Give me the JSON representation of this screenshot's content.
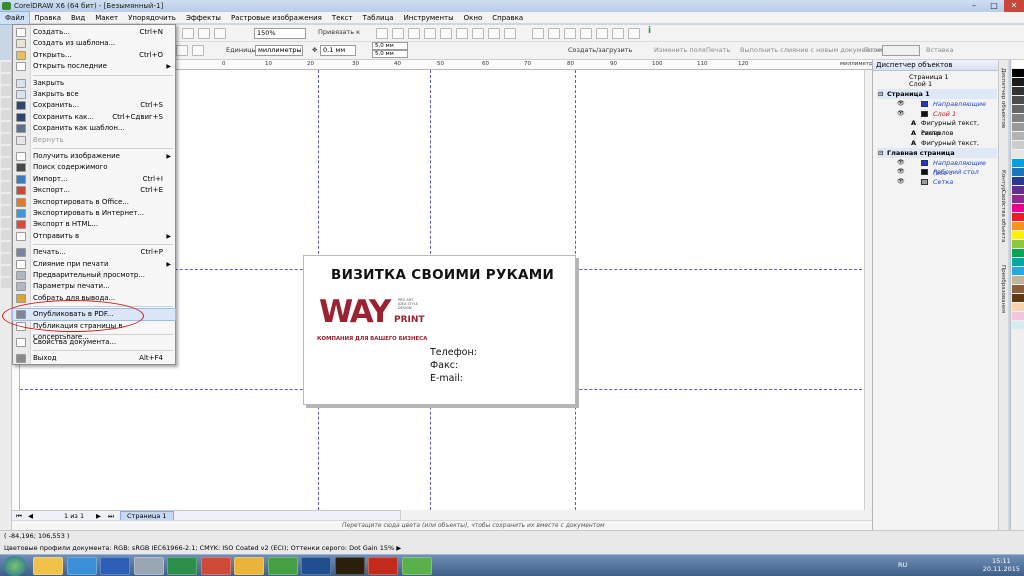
{
  "window": {
    "title": "CorelDRAW X6 (64 бит) - [Безымянный-1]"
  },
  "menubar": [
    "Файл",
    "Правка",
    "Вид",
    "Макет",
    "Упорядочить",
    "Эффекты",
    "Растровые изображения",
    "Текст",
    "Таблица",
    "Инструменты",
    "Окно",
    "Справка"
  ],
  "toolbar": {
    "zoom": "150%",
    "snap_label": "Привязать к",
    "units_label": "Единицы:",
    "units_value": "миллиметры",
    "nudge": "0,1 мм",
    "dup_x": "5,0 мм",
    "dup_y": "5,0 мм",
    "create_upload": "Создать/загрузить",
    "change_fields": "Изменить поля",
    "print": "Печать",
    "merge": "Выполнить слияние с новым документом",
    "field_label": "Поле:",
    "insert": "Вставка"
  },
  "ruler_h": [
    "-30",
    "-20",
    "0",
    "10",
    "20",
    "30",
    "40",
    "50",
    "60",
    "70",
    "80",
    "90",
    "100",
    "110",
    "120",
    "миллиметры"
  ],
  "file_menu": [
    {
      "label": "Создать...",
      "shortcut": "Ctrl+N",
      "icon": "new-doc-icon",
      "color": "#ffffff"
    },
    {
      "label": "Создать из шаблона...",
      "shortcut": "",
      "icon": "template-icon",
      "color": "#e9e3cf"
    },
    {
      "label": "Открыть...",
      "shortcut": "Ctrl+O",
      "icon": "open-icon",
      "color": "#e7c25a"
    },
    {
      "label": "Открыть последние",
      "shortcut": "",
      "icon": "recent-icon",
      "color": "#ffffff",
      "submenu": true
    },
    {
      "sep": true
    },
    {
      "label": "Закрыть",
      "shortcut": "",
      "icon": "close-doc-icon",
      "color": "#d8e3f1"
    },
    {
      "label": "Закрыть все",
      "shortcut": "",
      "icon": "close-all-icon",
      "color": "#d8e3f1"
    },
    {
      "label": "Сохранить...",
      "shortcut": "Ctrl+S",
      "icon": "save-icon",
      "color": "#30466f"
    },
    {
      "label": "Сохранить как...",
      "shortcut": "Ctrl+Сдвиг+S",
      "icon": "save-as-icon",
      "color": "#30466f"
    },
    {
      "label": "Сохранить как шаблон...",
      "shortcut": "",
      "icon": "save-template-icon",
      "color": "#5c6f8f"
    },
    {
      "label": "Вернуть",
      "shortcut": "",
      "icon": "revert-icon",
      "color": "#e6e6e6",
      "disabled": true
    },
    {
      "sep": true
    },
    {
      "label": "Получить изображение",
      "shortcut": "",
      "icon": "acquire-icon",
      "color": "#ffffff",
      "submenu": true
    },
    {
      "label": "Поиск содержимого",
      "shortcut": "",
      "icon": "search-icon",
      "color": "#4a4a4a"
    },
    {
      "label": "Импорт...",
      "shortcut": "Ctrl+I",
      "icon": "import-icon",
      "color": "#3a7bc8"
    },
    {
      "label": "Экспорт...",
      "shortcut": "Ctrl+E",
      "icon": "export-icon",
      "color": "#c84a3a"
    },
    {
      "label": "Экспортировать в Office...",
      "shortcut": "",
      "icon": "office-icon",
      "color": "#e07b2a"
    },
    {
      "label": "Экспортировать в Интернет...",
      "shortcut": "",
      "icon": "web-export-icon",
      "color": "#3a9ad9"
    },
    {
      "label": "Экспорт в HTML...",
      "shortcut": "",
      "icon": "html-icon",
      "color": "#d84a3a"
    },
    {
      "label": "Отправить в",
      "shortcut": "",
      "icon": "send-icon",
      "color": "#ffffff",
      "submenu": true
    },
    {
      "sep": true
    },
    {
      "label": "Печать...",
      "shortcut": "Ctrl+P",
      "icon": "print-icon",
      "color": "#7a8699"
    },
    {
      "label": "Слияние при печати",
      "shortcut": "",
      "icon": "merge-icon",
      "color": "#ffffff",
      "submenu": true
    },
    {
      "label": "Предварительный просмотр...",
      "shortcut": "",
      "icon": "preview-icon",
      "color": "#b0b8c4"
    },
    {
      "label": "Параметры печати...",
      "shortcut": "",
      "icon": "print-settings-icon",
      "color": "#b0b8c4"
    },
    {
      "label": "Собрать для вывода...",
      "shortcut": "",
      "icon": "collect-icon",
      "color": "#d7a63a"
    },
    {
      "sep": true
    },
    {
      "label": "Опубликовать в PDF...",
      "shortcut": "",
      "icon": "pdf-icon",
      "color": "#7a8699",
      "highlight": true
    },
    {
      "label": "Публикация страницы в ConceptShare...",
      "shortcut": "",
      "icon": "conceptshare-icon",
      "color": "#ffffff"
    },
    {
      "sep": true
    },
    {
      "label": "Свойства документа...",
      "shortcut": "",
      "icon": "properties-icon",
      "color": "#ffffff"
    },
    {
      "sep": true
    },
    {
      "label": "Выход",
      "shortcut": "Alt+F4",
      "icon": "exit-icon",
      "color": "#8a8a8a"
    }
  ],
  "card": {
    "title": "ВИЗИТКА СВОИМИ РУКАМИ",
    "logo_way": "WAY",
    "logo_print": "PRINT",
    "logo_small": "PRO ART IDEA STYLE DESIGN",
    "logo_tagline": "КОМПАНИЯ ДЛЯ ВАШЕГО БИЗНЕСА",
    "phone": "Телефон:",
    "fax": "Факс:",
    "email": "E-mail:"
  },
  "page_nav": {
    "counter": "1 из 1",
    "tab": "Страница 1"
  },
  "palette_hint": "Перетащите сюда цвета (или объекты), чтобы сохранить их вместе с документом",
  "status": {
    "coords": "( -84,196; 106,553 )",
    "profile": "Цветовые профили документа: RGB: sRGB IEC61966-2.1; CMYK: ISO Coated v2 (ECI); Оттенки серого: Dot Gain 15% ▶"
  },
  "docker": {
    "title": "Диспетчер объектов",
    "page_info": [
      "Страница 1",
      "Слой 1"
    ],
    "tree": [
      {
        "label": "Страница 1",
        "level": 0,
        "group": true,
        "style": "bold"
      },
      {
        "label": "Направляющие",
        "level": 1,
        "style": "blue",
        "swatch": "#1f37d6"
      },
      {
        "label": "Слой 1",
        "level": 1,
        "style": "red",
        "swatch": "#111111"
      },
      {
        "label": "Фигурный текст, символов",
        "level": 2,
        "style": "normal"
      },
      {
        "label": "Растр",
        "level": 2,
        "style": "normal"
      },
      {
        "label": "Фигурный текст, символов",
        "level": 2,
        "style": "normal"
      },
      {
        "label": "Главная страница",
        "level": 0,
        "group": true,
        "style": "bold"
      },
      {
        "label": "Направляющие (все с",
        "level": 1,
        "style": "blue",
        "swatch": "#1f37d6"
      },
      {
        "label": "Рабочий стол",
        "level": 1,
        "style": "blue",
        "swatch": "#111111"
      },
      {
        "label": "Сетка",
        "level": 1,
        "style": "blue",
        "swatch": "#9a9a9a"
      }
    ]
  },
  "docker_tabs": [
    "Диспетчер объектов",
    "Контур",
    "Свойства объекта",
    "Преобразования"
  ],
  "palette_colors": [
    "#ffffff",
    "#000000",
    "#1a1a1a",
    "#333333",
    "#4d4d4d",
    "#666666",
    "#808080",
    "#999999",
    "#b3b3b3",
    "#cccccc",
    "#e6e6e6",
    "#00a0e3",
    "#1b75bb",
    "#283891",
    "#662d91",
    "#92278f",
    "#ec008c",
    "#ed1c24",
    "#f7941d",
    "#fff200",
    "#8dc63f",
    "#00a651",
    "#00a99d",
    "#27aae1",
    "#c2b59b",
    "#8b5e3c",
    "#603913",
    "#f9d3ad",
    "#f3c6dd",
    "#d6ecf3"
  ],
  "taskbar": {
    "lang": "RU",
    "time": "15:11",
    "date": "20.11.2015"
  },
  "taskbar_apps": [
    "explorer-icon",
    "ie-icon",
    "word-icon",
    "tools-icon",
    "excel-icon",
    "paint-icon",
    "chrome-icon",
    "coreldraw-icon",
    "photoshop-icon",
    "illustrator-icon",
    "pdf-reader-icon",
    "corel-green-icon"
  ]
}
